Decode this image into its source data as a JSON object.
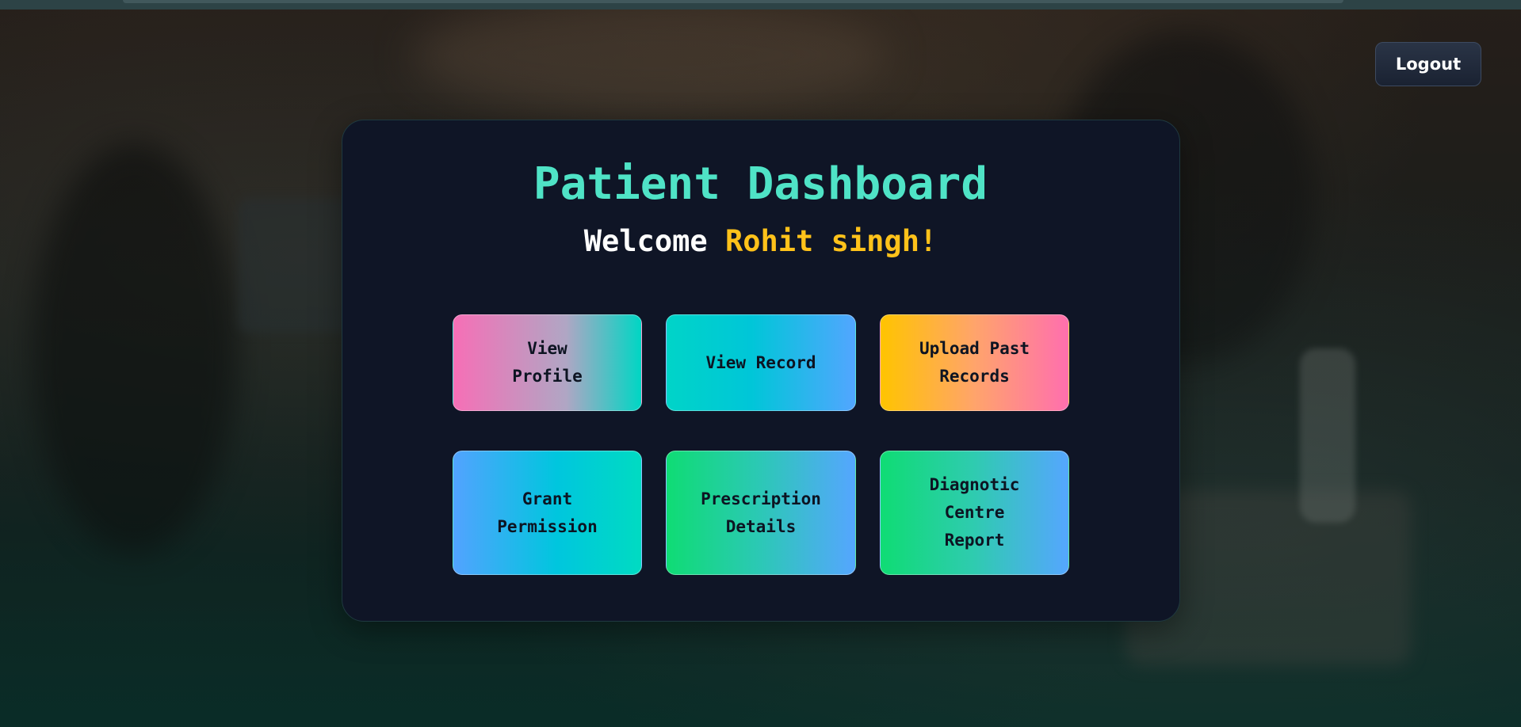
{
  "header": {
    "logout_label": "Logout"
  },
  "dashboard": {
    "title": "Patient Dashboard",
    "welcome_prefix": "Welcome",
    "user_name": "Rohit singh!"
  },
  "tiles": [
    {
      "label": "View\nProfile"
    },
    {
      "label": "View Record"
    },
    {
      "label": "Upload Past\nRecords"
    },
    {
      "label": "Grant\nPermission"
    },
    {
      "label": "Prescription\nDetails"
    },
    {
      "label": "Diagnotic\nCentre\nReport"
    }
  ],
  "colors": {
    "title": "#4fe3c6",
    "user_name": "#ffc21a",
    "card_background": "#0f1526"
  }
}
